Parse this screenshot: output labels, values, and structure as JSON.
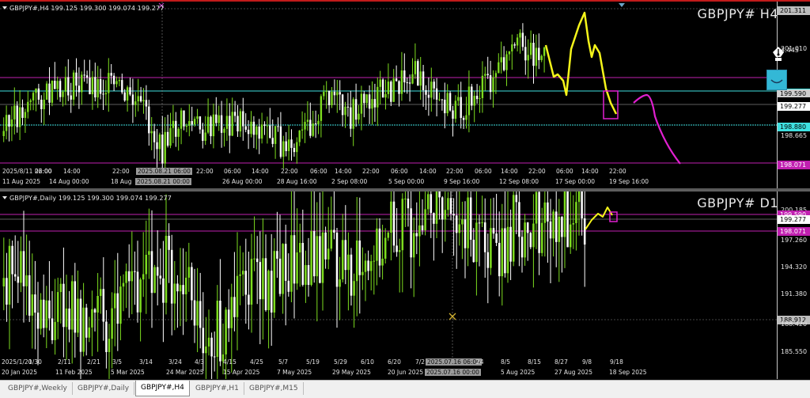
{
  "panes": [
    {
      "id": "h4",
      "info_text": "GBPJPY#,H4  199.125 199.300 199.074 199.277",
      "big_title": "GBPJPY# H4",
      "y_labels": [
        "201.311",
        "201.010",
        "3.445",
        "199.590",
        "199.277",
        "198.880",
        "198.665",
        "198.071"
      ],
      "x_top": [
        "2025/8/11 22:00",
        "06:00",
        "14:00",
        "22:00",
        "2025.08.21 06:00",
        "22:00",
        "06:00",
        "14:00",
        "22:00",
        "06:00",
        "14:00",
        "22:00",
        "06:00",
        "14:00",
        "22:00",
        "06:00",
        "14:00",
        "22:00",
        "06:00",
        "14:00",
        "22:00"
      ],
      "x_bottom": [
        "11 Aug 2025",
        "14 Aug 00:00",
        "18 Aug",
        "2025.08.21 00:00",
        "26 Aug 00:00",
        "28 Aug 16:00",
        "2 Sep 08:00",
        "5 Sep 00:00",
        "9 Sep 16:00",
        "12 Sep 08:00",
        "17 Sep 00:00",
        "19 Sep 16:00"
      ]
    },
    {
      "id": "d1",
      "info_text": "GBPJPY#,Daily  199.125 199.300 199.074 199.277",
      "big_title": "GBPJPY# D1",
      "y_labels": [
        "200.185",
        "199.590",
        "199.277",
        "198.071",
        "197.260",
        "194.320",
        "191.380",
        "188.912",
        "188.420",
        "185.550"
      ],
      "x_top": [
        "2025/1/20",
        "1/30",
        "2/11",
        "2/21",
        "3/5",
        "3/14",
        "3/24",
        "4/3",
        "4/15",
        "4/25",
        "5/7",
        "5/19",
        "5/29",
        "6/10",
        "6/20",
        "7/2",
        "2025.07.16 06:00",
        "24",
        "8/5",
        "8/15",
        "8/27",
        "9/8",
        "9/18"
      ],
      "x_bottom": [
        "20 Jan 2025",
        "11 Feb 2025",
        "5 Mar 2025",
        "24 Mar 2025",
        "15 Apr 2025",
        "7 May 2025",
        "29 May 2025",
        "20 Jun 2025",
        "2025.07.16 00:00",
        "5 Aug 2025",
        "27 Aug 2025",
        "18 Sep 2025"
      ]
    }
  ],
  "tabs": [
    "GBPJPY#,Weekly",
    "GBPJPY#,Daily",
    "GBPJPY#,H4",
    "GBPJPY#,H1",
    "GBPJPY#,M15"
  ],
  "active_tab": "GBPJPY#,H4",
  "colors": {
    "background": "#000000",
    "bull_candle": "#7ddc1f",
    "bear_candle": "#ffffff",
    "level_magenta": "#c020b0",
    "level_cyan": "#3fe0e0",
    "drawing_yellow": "#f5f51a",
    "drawing_magenta": "#e020d0"
  },
  "icons": [
    "pen-nib-icon",
    "smile-button-icon",
    "crosshair-marker-icon"
  ]
}
